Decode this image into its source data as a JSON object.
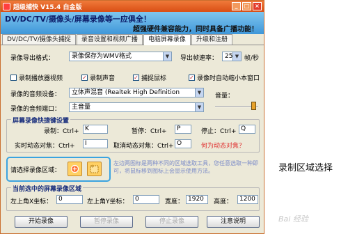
{
  "window": {
    "title": "超级捕快 V15.4 白金版",
    "banner_title": "DV/DC/TV/摄像头/屏幕录像等一应俱全！",
    "banner_subtitle": "超强硬件兼容能力，同时具备广播功能！"
  },
  "tabs": [
    {
      "label": "DV/DC/TV/摄像头捕捉"
    },
    {
      "label": "录音设置和视频广播"
    },
    {
      "label": "电脑屏幕录像"
    },
    {
      "label": "升级和注册"
    }
  ],
  "form": {
    "export_format_label": "录像导出格式：",
    "export_format_value": "录像保存为WMV格式",
    "fps_label": "导出帧速率：",
    "fps_value": "25",
    "fps_unit": "帧/秒",
    "cb_player": "录制播放器视频",
    "cb_sound": "录制声音",
    "cb_mouse": "捕捉鼠标",
    "cb_minimize": "录像时自动缩小本窗口",
    "audio_device_label": "录像的音频设备：",
    "audio_device_value": "立体声混音 (Realtek High Definition",
    "volume_label": "音量：",
    "audio_port_label": "录像的音频端口：",
    "audio_port_value": "主音量"
  },
  "hotkeys": {
    "title": "屏幕录像快捷键设置",
    "record_label": "录制：Ctrl+",
    "record_value": "K",
    "pause_label": "暂停：Ctrl+",
    "pause_value": "P",
    "stop_label": "停止：Ctrl+",
    "stop_value": "Q",
    "focus_label": "实时动态对焦：Ctrl+",
    "focus_value": "I",
    "cancel_focus_label": "取消动态对焦：Ctrl+",
    "cancel_focus_value": "O",
    "what_link": "何为动态对焦？"
  },
  "area": {
    "label": "请选择录像区域：",
    "note": "左边两图标是两种不同的区域选取工具，您任意选取一种即可，将鼠标移到图标上会显示使用方法。"
  },
  "current_area": {
    "title": "当前选中的屏幕录像区域",
    "x_label": "左上角X坐标：",
    "x_value": "0",
    "y_label": "左上角Y坐标：",
    "y_value": "0",
    "width_label": "宽度：",
    "width_value": "1920",
    "height_label": "高度：",
    "height_value": "1200"
  },
  "buttons": {
    "start": "开始录像",
    "pause": "暂停录像",
    "stop": "停止录像",
    "notes": "注意说明"
  },
  "annotation": {
    "side_label": "录制区域选择"
  },
  "watermark": "Bai 经验",
  "colors": {
    "accent": "#d94e15",
    "banner": "#3f97d9",
    "highlight_border": "#3aa3e0",
    "link": "#e03131"
  }
}
